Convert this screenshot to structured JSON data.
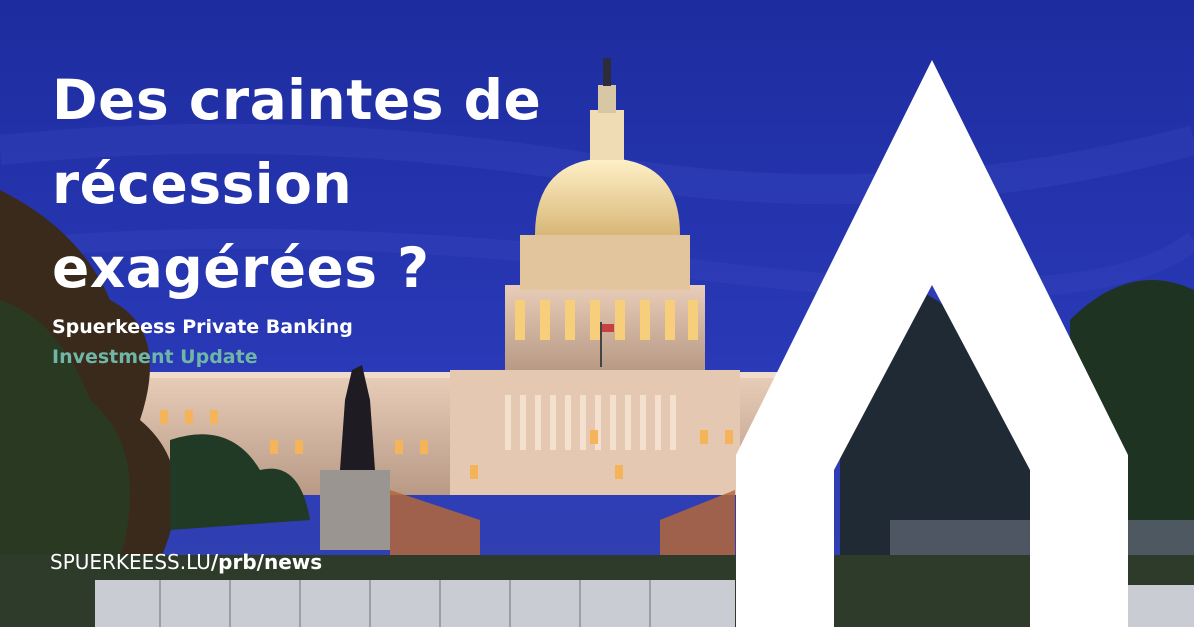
{
  "headline": {
    "line1": "Des craintes de",
    "line2": "récession",
    "line3": "exagérées ?"
  },
  "brand": "Spuerkeess Private Banking",
  "subtitle": "Investment Update",
  "url": {
    "domain": "SPUERKEESS.LU",
    "sep1": "/",
    "path1": "prb",
    "sep2": "/",
    "path2": "news"
  },
  "colors": {
    "sky": "#2a33b5",
    "accent": "#6fb6a8",
    "text": "#ffffff",
    "logo": "#ffffff"
  },
  "icons": [
    "capitol-photo",
    "spuerkeess-logo-icon"
  ]
}
